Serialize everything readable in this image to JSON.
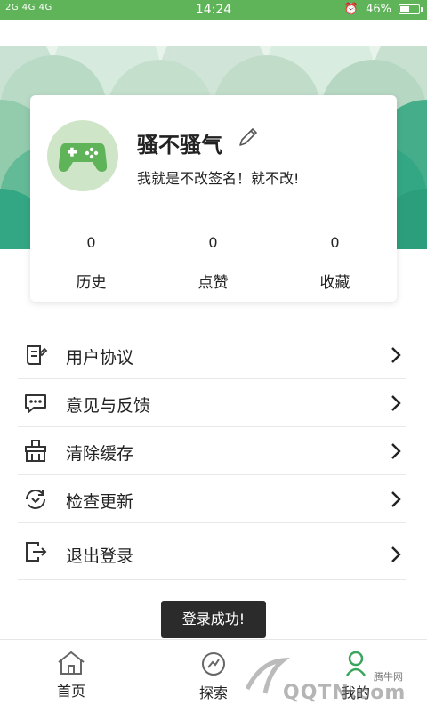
{
  "status_bar": {
    "signal": "2G 4G 4G",
    "time": "14:24",
    "battery_text": "46%",
    "battery_level": 0.46
  },
  "profile": {
    "nickname": "骚不骚气",
    "signature": "我就是不改签名！就不改!",
    "avatar_icon": "gamepad-icon",
    "stats": [
      {
        "count": "0",
        "label": "历史"
      },
      {
        "count": "0",
        "label": "点赞"
      },
      {
        "count": "0",
        "label": "收藏"
      }
    ]
  },
  "menu": [
    {
      "label": "用户协议",
      "icon": "document-icon"
    },
    {
      "label": "意见与反馈",
      "icon": "chat-icon"
    },
    {
      "label": "清除缓存",
      "icon": "broom-icon"
    },
    {
      "label": "检查更新",
      "icon": "refresh-icon"
    },
    {
      "label": "退出登录",
      "icon": "logout-icon"
    }
  ],
  "toast": "登录成功!",
  "tabs": [
    {
      "label": "首页",
      "icon": "home-icon"
    },
    {
      "label": "探索",
      "icon": "compass-icon"
    },
    {
      "label": "我的",
      "icon": "profile-icon",
      "active": true
    }
  ],
  "watermark": {
    "brand": "腾牛网",
    "url": "QQTN.com"
  },
  "colors": {
    "accent": "#5fb359",
    "header_teal": "#2aa37f",
    "toast_bg": "#2b2b2b"
  }
}
